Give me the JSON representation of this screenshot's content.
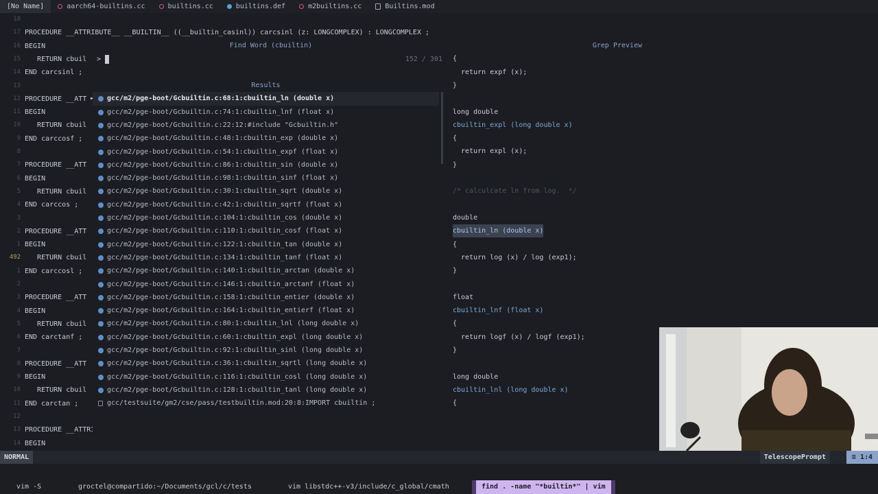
{
  "tabs": [
    {
      "label": "[No Name]",
      "icon": "",
      "active": true
    },
    {
      "label": "aarch64-builtins.cc",
      "icon": "cc-file-icon"
    },
    {
      "label": "builtins.cc",
      "icon": "cc-file-icon"
    },
    {
      "label": "builtins.def",
      "icon": "def-file-icon"
    },
    {
      "label": "m2builtins.cc",
      "icon": "cc-file-icon"
    },
    {
      "label": "Builtins.mod",
      "icon": "mod-file-icon"
    }
  ],
  "editor": {
    "lines": [
      {
        "n": "18",
        "t": ""
      },
      {
        "n": "17",
        "t": "PROCEDURE __ATTRIBUTE__ __BUILTIN__ ((__builtin_casinl)) carcsinl (z: LONGCOMPLEX) : LONGCOMPLEX ;"
      },
      {
        "n": "16",
        "t": "BEGIN"
      },
      {
        "n": "15",
        "t": "   RETURN cbuil"
      },
      {
        "n": "14",
        "t": "END carcsinl ;"
      },
      {
        "n": "13",
        "t": ""
      },
      {
        "n": "12",
        "t": "PROCEDURE __ATT"
      },
      {
        "n": "11",
        "t": "BEGIN"
      },
      {
        "n": "10",
        "t": "   RETURN cbuil"
      },
      {
        "n": "9",
        "t": "END carccosf ;"
      },
      {
        "n": "8",
        "t": ""
      },
      {
        "n": "7",
        "t": "PROCEDURE __ATT"
      },
      {
        "n": "6",
        "t": "BEGIN"
      },
      {
        "n": "5",
        "t": "   RETURN cbuil"
      },
      {
        "n": "4",
        "t": "END carccos ;"
      },
      {
        "n": "3",
        "t": ""
      },
      {
        "n": "2",
        "t": "PROCEDURE __ATT"
      },
      {
        "n": "1",
        "t": "BEGIN"
      },
      {
        "n": "492",
        "t": "   RETURN cbuil"
      },
      {
        "n": "1",
        "t": "END carccosl ;"
      },
      {
        "n": "2",
        "t": ""
      },
      {
        "n": "3",
        "t": "PROCEDURE __ATT"
      },
      {
        "n": "4",
        "t": "BEGIN"
      },
      {
        "n": "5",
        "t": "   RETURN cbuil"
      },
      {
        "n": "6",
        "t": "END carctanf ;"
      },
      {
        "n": "7",
        "t": ""
      },
      {
        "n": "8",
        "t": "PROCEDURE __ATT"
      },
      {
        "n": "9",
        "t": "BEGIN"
      },
      {
        "n": "10",
        "t": "   RETURN cbuil"
      },
      {
        "n": "11",
        "t": "END carctan ;"
      },
      {
        "n": "12",
        "t": ""
      },
      {
        "n": "13",
        "t": "PROCEDURE __ATTRIBUTE__ __BUILTIN__ ((__builtin_catanl)) carctanl (z: LONGCOMPLEX) : LONGCOMPLEX ;"
      },
      {
        "n": "14",
        "t": "BEGIN"
      }
    ]
  },
  "telescope": {
    "prompt_title": "Find Word (cbuiltin)",
    "count": "152 / 301",
    "prompt_caret": ">",
    "results_title": "Results",
    "preview_title": "Grep Preview",
    "results": [
      "gcc/m2/pge-boot/Gcbuiltin.c:68:1:cbuiltin_ln (double x)",
      "gcc/m2/pge-boot/Gcbuiltin.c:74:1:cbuiltin_lnf (float x)",
      "gcc/m2/pge-boot/Gcbuiltin.c:22:12:#include \"Gcbuiltin.h\"",
      "gcc/m2/pge-boot/Gcbuiltin.c:48:1:cbuiltin_exp (double x)",
      "gcc/m2/pge-boot/Gcbuiltin.c:54:1:cbuiltin_expf (float x)",
      "gcc/m2/pge-boot/Gcbuiltin.c:86:1:cbuiltin_sin (double x)",
      "gcc/m2/pge-boot/Gcbuiltin.c:98:1:cbuiltin_sinf (float x)",
      "gcc/m2/pge-boot/Gcbuiltin.c:30:1:cbuiltin_sqrt (double x)",
      "gcc/m2/pge-boot/Gcbuiltin.c:42:1:cbuiltin_sqrtf (float x)",
      "gcc/m2/pge-boot/Gcbuiltin.c:104:1:cbuiltin_cos (double x)",
      "gcc/m2/pge-boot/Gcbuiltin.c:110:1:cbuiltin_cosf (float x)",
      "gcc/m2/pge-boot/Gcbuiltin.c:122:1:cbuiltin_tan (double x)",
      "gcc/m2/pge-boot/Gcbuiltin.c:134:1:cbuiltin_tanf (float x)",
      "gcc/m2/pge-boot/Gcbuiltin.c:140:1:cbuiltin_arctan (double x)",
      "gcc/m2/pge-boot/Gcbuiltin.c:146:1:cbuiltin_arctanf (float x)",
      "gcc/m2/pge-boot/Gcbuiltin.c:158:1:cbuiltin_entier (double x)",
      "gcc/m2/pge-boot/Gcbuiltin.c:164:1:cbuiltin_entierf (float x)",
      "gcc/m2/pge-boot/Gcbuiltin.c:80:1:cbuiltin_lnl (long double x)",
      "gcc/m2/pge-boot/Gcbuiltin.c:60:1:cbuiltin_expl (long double x)",
      "gcc/m2/pge-boot/Gcbuiltin.c:92:1:cbuiltin_sinl (long double x)",
      "gcc/m2/pge-boot/Gcbuiltin.c:36:1:cbuiltin_sqrtl (long double x)",
      "gcc/m2/pge-boot/Gcbuiltin.c:116:1:cbuiltin_cosl (long double x)",
      "gcc/m2/pge-boot/Gcbuiltin.c:128:1:cbuiltin_tanl (long double x)",
      "gcc/testsuite/gm2/cse/pass/testbuiltin.mod:20:8:IMPORT cbuiltin ;"
    ],
    "preview": [
      "{",
      "  return expf (x);",
      "}",
      "",
      "long double",
      "cbuiltin_expl (long double x)",
      "{",
      "  return expl (x);",
      "}",
      "",
      "/* calculcate ln from log.  */",
      "",
      "double",
      "cbuiltin_ln (double x)",
      "{",
      "  return log (x) / log (exp1);",
      "}",
      "",
      "float",
      "cbuiltin_lnf (float x)",
      "{",
      "  return logf (x) / logf (exp1);",
      "}",
      "",
      "long double",
      "cbuiltin_lnl (long double x)",
      "{"
    ]
  },
  "statusline": {
    "mode": "NORMAL",
    "filetype": "TelescopePrompt",
    "position": "1:4",
    "position_icon": "≡"
  },
  "tmux": {
    "windows": [
      {
        "label": "vim -S"
      },
      {
        "label": "groctel@compartido:~/Documents/gcl/c/tests"
      },
      {
        "label": "vim libstdc++-v3/include/c_global/cmath"
      },
      {
        "label": "find . -name \"*builtin*\" | vim",
        "active": true
      }
    ]
  }
}
